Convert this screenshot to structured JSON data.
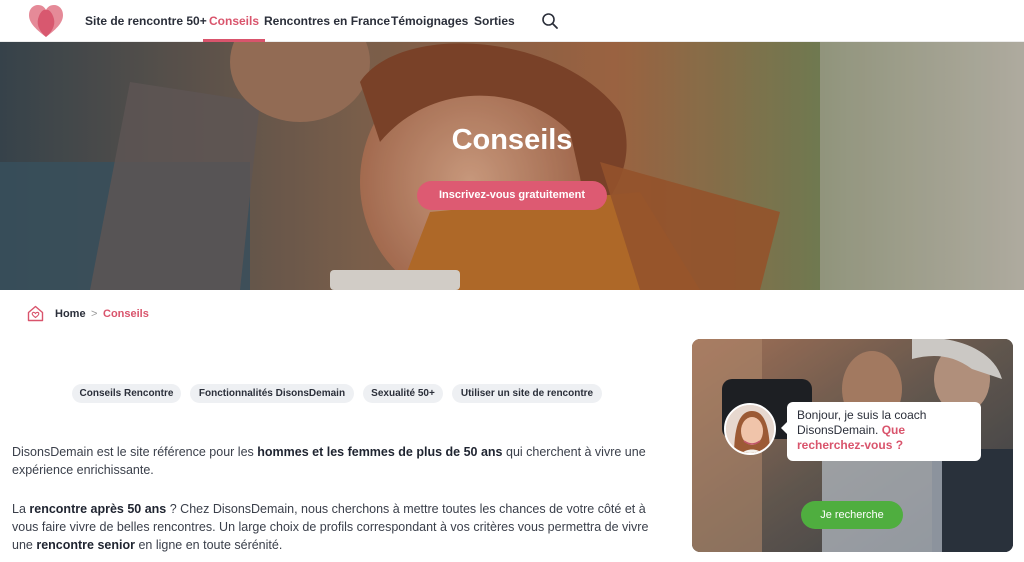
{
  "nav": {
    "logo_icon": "heart-logo",
    "items": [
      {
        "label": "Site de rencontre 50+",
        "active": false
      },
      {
        "label": "Conseils",
        "active": true
      },
      {
        "label": "Rencontres en France",
        "active": false
      },
      {
        "label": "Témoignages",
        "active": false
      },
      {
        "label": "Sorties",
        "active": false
      }
    ],
    "search_icon": "search-icon"
  },
  "hero": {
    "title": "Conseils",
    "cta_label": "Inscrivez-vous gratuitement"
  },
  "breadcrumb": {
    "home_icon": "home-heart-icon",
    "home": "Home",
    "separator": ">",
    "current": "Conseils"
  },
  "tags": [
    "Conseils Rencontre",
    "Fonctionnalités DisonsDemain",
    "Sexualité 50+",
    "Utiliser un site de rencontre"
  ],
  "content": {
    "p1": {
      "a": "DisonsDemain est le site référence pour les ",
      "b": "hommes et les femmes de plus de 50 ans",
      "c": " qui cherchent à vivre une expérience enrichissante."
    },
    "p2": {
      "a": "La ",
      "b": "rencontre après 50 ans",
      "c": " ? Chez DisonsDemain, nous cherchons à mettre toutes les chances de votre côté et à vous faire vivre de belles rencontres. Un large choix de profils correspondant à vos critères vous permettra de vivre une ",
      "d": "rencontre senior",
      "e": " en ligne en toute sérénité."
    }
  },
  "coach": {
    "bubble_text": "Bonjour, je suis la coach DisonsDemain. ",
    "bubble_question": "Que recherchez-vous ?",
    "button_label": "Je recherche"
  },
  "colors": {
    "accent": "#d9546c",
    "cta": "#dd5a72",
    "coach_button": "#4fae3f",
    "tag_bg": "#eef0f3"
  }
}
